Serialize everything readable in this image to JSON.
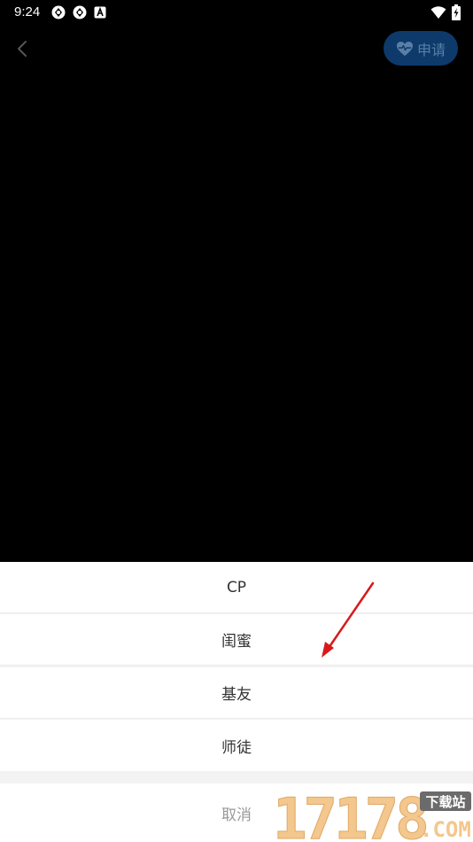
{
  "status_bar": {
    "time": "9:24"
  },
  "nav": {
    "apply_label": "申请"
  },
  "sheet": {
    "options": [
      "CP",
      "闺蜜",
      "基友",
      "师徒"
    ],
    "cancel_label": "取消"
  },
  "watermark": {
    "text": "17178",
    "sub_top": "下载站",
    "sub_bottom": ".COM"
  },
  "colors": {
    "apply_bg": "#0d3a6b",
    "apply_fg": "#5a7fa6",
    "arrow": "#d8191a",
    "watermark": "#f3c78d"
  }
}
